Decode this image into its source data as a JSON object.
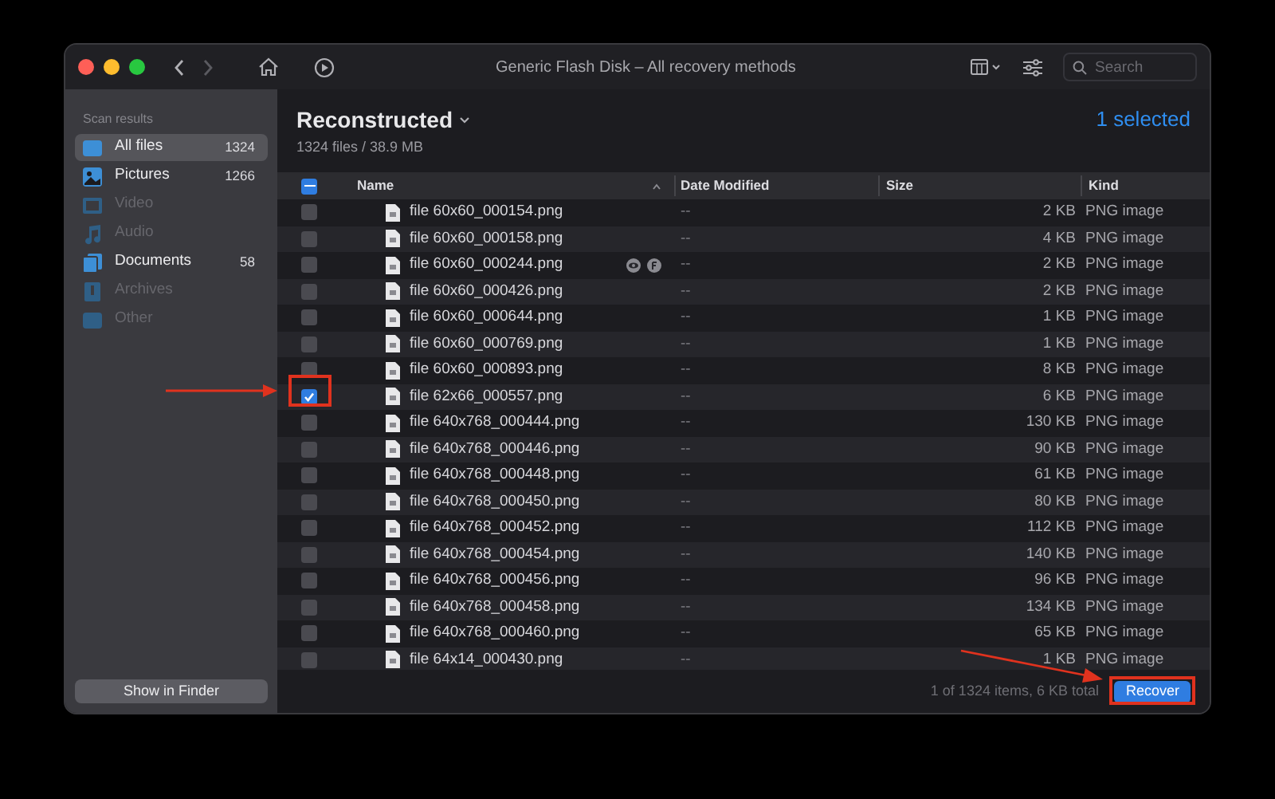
{
  "window": {
    "title": "Generic Flash Disk – All recovery methods"
  },
  "search": {
    "placeholder": "Search"
  },
  "sidebar": {
    "heading": "Scan results",
    "items": [
      {
        "label": "All files",
        "count": "1324",
        "selected": true,
        "disabled": false,
        "kind": "all"
      },
      {
        "label": "Pictures",
        "count": "1266",
        "selected": false,
        "disabled": false,
        "kind": "pictures"
      },
      {
        "label": "Video",
        "selected": false,
        "disabled": true,
        "kind": "video"
      },
      {
        "label": "Audio",
        "selected": false,
        "disabled": true,
        "kind": "audio"
      },
      {
        "label": "Documents",
        "count": "58",
        "selected": false,
        "disabled": false,
        "kind": "documents"
      },
      {
        "label": "Archives",
        "selected": false,
        "disabled": true,
        "kind": "archives"
      },
      {
        "label": "Other",
        "selected": false,
        "disabled": true,
        "kind": "other"
      }
    ],
    "button": "Show in Finder"
  },
  "header": {
    "title": "Reconstructed",
    "subtitle": "1324 files / 38.9 MB",
    "selection": "1 selected"
  },
  "table": {
    "select_all": {
      "mixed": true
    },
    "columns": [
      "Name",
      "Date Modified",
      "Size",
      "Kind"
    ],
    "rows": [
      {
        "name": "file 60x60_000154.png",
        "date": "--",
        "size": "2 KB",
        "kind": "PNG image",
        "checked": false,
        "hovered": false
      },
      {
        "name": "file 60x60_000158.png",
        "date": "--",
        "size": "4 KB",
        "kind": "PNG image",
        "checked": false,
        "hovered": false
      },
      {
        "name": "file 60x60_000244.png",
        "date": "--",
        "size": "2 KB",
        "kind": "PNG image",
        "checked": false,
        "hovered": true
      },
      {
        "name": "file 60x60_000426.png",
        "date": "--",
        "size": "2 KB",
        "kind": "PNG image",
        "checked": false,
        "hovered": false
      },
      {
        "name": "file 60x60_000644.png",
        "date": "--",
        "size": "1 KB",
        "kind": "PNG image",
        "checked": false,
        "hovered": false
      },
      {
        "name": "file 60x60_000769.png",
        "date": "--",
        "size": "1 KB",
        "kind": "PNG image",
        "checked": false,
        "hovered": false
      },
      {
        "name": "file 60x60_000893.png",
        "date": "--",
        "size": "8 KB",
        "kind": "PNG image",
        "checked": false,
        "hovered": false
      },
      {
        "name": "file 62x66_000557.png",
        "date": "--",
        "size": "6 KB",
        "kind": "PNG image",
        "checked": true,
        "hovered": false
      },
      {
        "name": "file 640x768_000444.png",
        "date": "--",
        "size": "130 KB",
        "kind": "PNG image",
        "checked": false,
        "hovered": false
      },
      {
        "name": "file 640x768_000446.png",
        "date": "--",
        "size": "90 KB",
        "kind": "PNG image",
        "checked": false,
        "hovered": false
      },
      {
        "name": "file 640x768_000448.png",
        "date": "--",
        "size": "61 KB",
        "kind": "PNG image",
        "checked": false,
        "hovered": false
      },
      {
        "name": "file 640x768_000450.png",
        "date": "--",
        "size": "80 KB",
        "kind": "PNG image",
        "checked": false,
        "hovered": false
      },
      {
        "name": "file 640x768_000452.png",
        "date": "--",
        "size": "112 KB",
        "kind": "PNG image",
        "checked": false,
        "hovered": false
      },
      {
        "name": "file 640x768_000454.png",
        "date": "--",
        "size": "140 KB",
        "kind": "PNG image",
        "checked": false,
        "hovered": false
      },
      {
        "name": "file 640x768_000456.png",
        "date": "--",
        "size": "96 KB",
        "kind": "PNG image",
        "checked": false,
        "hovered": false
      },
      {
        "name": "file 640x768_000458.png",
        "date": "--",
        "size": "134 KB",
        "kind": "PNG image",
        "checked": false,
        "hovered": false
      },
      {
        "name": "file 640x768_000460.png",
        "date": "--",
        "size": "65 KB",
        "kind": "PNG image",
        "checked": false,
        "hovered": false
      },
      {
        "name": "file 64x14_000430.png",
        "date": "--",
        "size": "1 KB",
        "kind": "PNG image",
        "checked": false,
        "hovered": false
      }
    ]
  },
  "footer": {
    "status": "1 of 1324 items, 6 KB total",
    "button": "Recover"
  }
}
